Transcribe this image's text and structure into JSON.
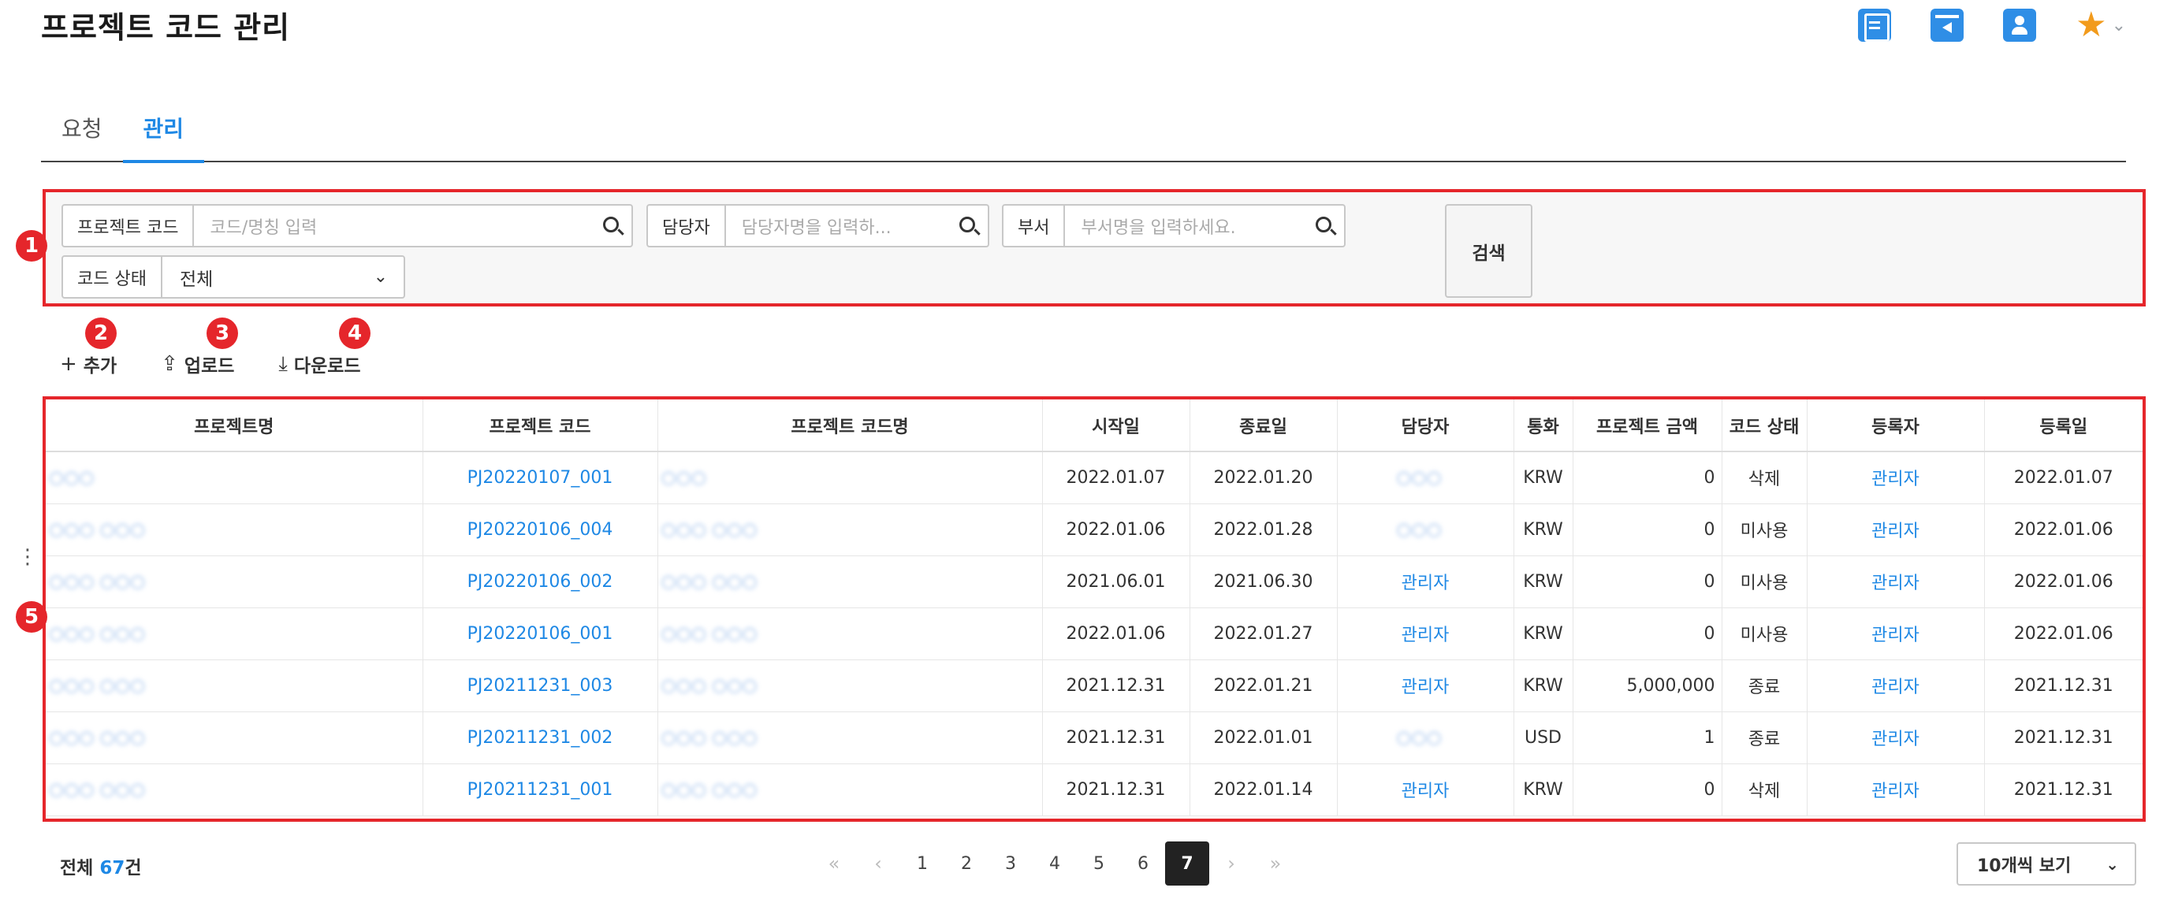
{
  "header": {
    "title": "프로젝트 코드 관리",
    "icons": [
      "document-icon",
      "board-icon",
      "user-badge-icon",
      "star-icon"
    ]
  },
  "tabs": [
    {
      "label": "요청",
      "active": false
    },
    {
      "label": "관리",
      "active": true
    }
  ],
  "markers": [
    "1",
    "2",
    "3",
    "4",
    "5"
  ],
  "filters": {
    "project_code": {
      "label": "프로젝트 코드",
      "placeholder": "코드/명칭 입력"
    },
    "manager": {
      "label": "담당자",
      "placeholder": "담당자명을 입력하..."
    },
    "department": {
      "label": "부서",
      "placeholder": "부서명을 입력하세요."
    },
    "code_status": {
      "label": "코드 상태",
      "value": "전체"
    },
    "search_button": "검색"
  },
  "actions": {
    "add": "추가",
    "upload": "업로드",
    "download": "다운로드"
  },
  "table": {
    "columns": [
      "프로젝트명",
      "프로젝트 코드",
      "프로젝트 코드명",
      "시작일",
      "종료일",
      "담당자",
      "통화",
      "프로젝트 금액",
      "코드 상태",
      "등록자",
      "등록일"
    ],
    "rows": [
      {
        "name": "○○○",
        "code": "PJ20220107_001",
        "code_name": "○○○",
        "start": "2022.01.07",
        "end": "2022.01.20",
        "manager": "○○○",
        "currency": "KRW",
        "amount": "0",
        "status": "삭제",
        "registrant": "관리자",
        "registered": "2022.01.07"
      },
      {
        "name": "○○○ ○○○",
        "code": "PJ20220106_004",
        "code_name": "○○○ ○○○",
        "start": "2022.01.06",
        "end": "2022.01.28",
        "manager": "○○○",
        "currency": "KRW",
        "amount": "0",
        "status": "미사용",
        "registrant": "관리자",
        "registered": "2022.01.06"
      },
      {
        "name": "○○○ ○○○",
        "code": "PJ20220106_002",
        "code_name": "○○○ ○○○",
        "start": "2021.06.01",
        "end": "2021.06.30",
        "manager": "관리자",
        "currency": "KRW",
        "amount": "0",
        "status": "미사용",
        "registrant": "관리자",
        "registered": "2022.01.06"
      },
      {
        "name": "○○○ ○○○",
        "code": "PJ20220106_001",
        "code_name": "○○○ ○○○",
        "start": "2022.01.06",
        "end": "2022.01.27",
        "manager": "관리자",
        "currency": "KRW",
        "amount": "0",
        "status": "미사용",
        "registrant": "관리자",
        "registered": "2022.01.06"
      },
      {
        "name": "○○○ ○○○",
        "code": "PJ20211231_003",
        "code_name": "○○○ ○○○",
        "start": "2021.12.31",
        "end": "2022.01.21",
        "manager": "관리자",
        "currency": "KRW",
        "amount": "5,000,000",
        "status": "종료",
        "registrant": "관리자",
        "registered": "2021.12.31"
      },
      {
        "name": "○○○ ○○○",
        "code": "PJ20211231_002",
        "code_name": "○○○ ○○○",
        "start": "2021.12.31",
        "end": "2022.01.01",
        "manager": "○○○",
        "currency": "USD",
        "amount": "1",
        "status": "종료",
        "registrant": "관리자",
        "registered": "2021.12.31"
      },
      {
        "name": "○○○ ○○○",
        "code": "PJ20211231_001",
        "code_name": "○○○ ○○○",
        "start": "2021.12.31",
        "end": "2022.01.14",
        "manager": "관리자",
        "currency": "KRW",
        "amount": "0",
        "status": "삭제",
        "registrant": "관리자",
        "registered": "2021.12.31"
      }
    ]
  },
  "footer": {
    "total_prefix": "전체",
    "total_count": "67",
    "total_suffix": "건",
    "pages": [
      "1",
      "2",
      "3",
      "4",
      "5",
      "6",
      "7"
    ],
    "current_page": "7",
    "page_size": "10개씩 보기"
  },
  "colors": {
    "accent": "#1e88e5",
    "highlight_red": "#e5262b",
    "star": "#f29b1c"
  }
}
